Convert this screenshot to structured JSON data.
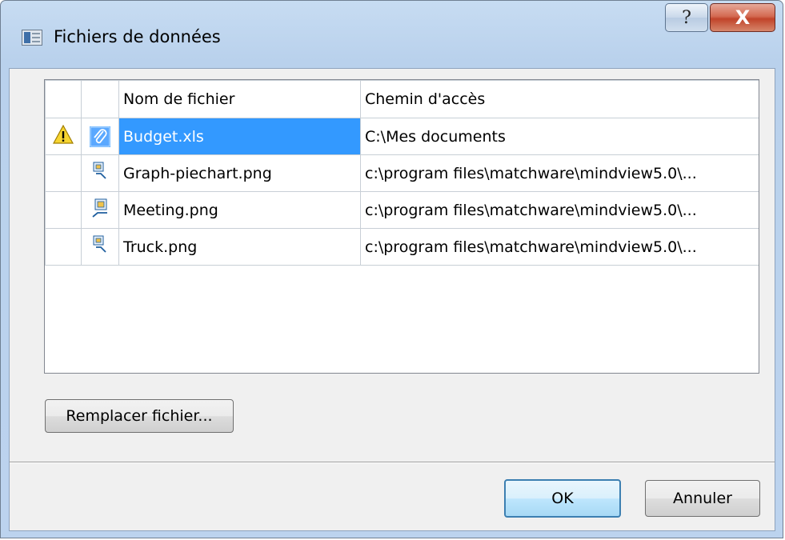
{
  "window": {
    "title": "Fichiers de données",
    "help_label": "?",
    "close_label": "X"
  },
  "table": {
    "columns": [
      "",
      "",
      "Nom de fichier",
      "Chemin d'accès"
    ],
    "rows": [
      {
        "warning_icon": "warning-icon",
        "type_icon": "paperclip-icon",
        "name": "Budget.xls",
        "path": "C:\\Mes documents",
        "selected": true
      },
      {
        "warning_icon": "",
        "type_icon": "image-file-icon",
        "name": "Graph-piechart.png",
        "path": "c:\\program files\\matchware\\mindview5.0\\...",
        "selected": false
      },
      {
        "warning_icon": "",
        "type_icon": "image-file-icon",
        "name": "Meeting.png",
        "path": "c:\\program files\\matchware\\mindview5.0\\...",
        "selected": false
      },
      {
        "warning_icon": "",
        "type_icon": "image-file-icon",
        "name": "Truck.png",
        "path": "c:\\program files\\matchware\\mindview5.0\\...",
        "selected": false
      }
    ]
  },
  "buttons": {
    "replace_label": "Remplacer fichier...",
    "ok_label": "OK",
    "cancel_label": "Annuler"
  },
  "colors": {
    "selection": "#3399ff",
    "title_bar": "#c7dcf2",
    "close_button": "#c1442a"
  }
}
